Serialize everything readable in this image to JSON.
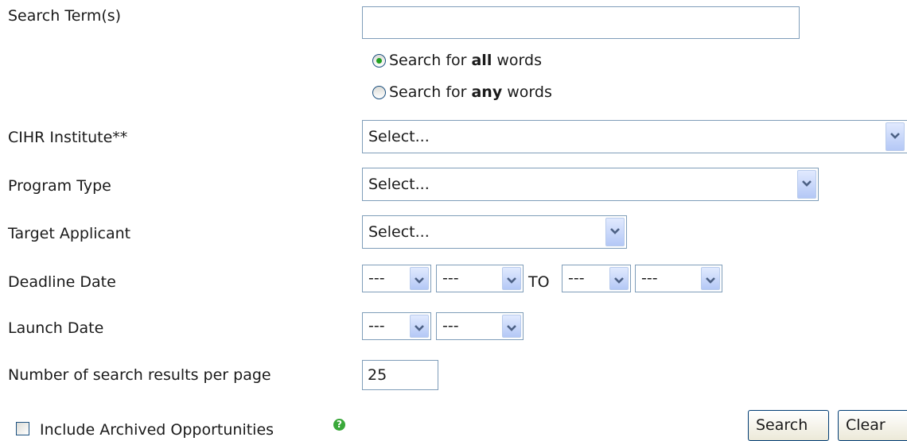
{
  "labels": {
    "search_terms": "Search Term(s)",
    "cihr_institute": "CIHR Institute**",
    "program_type": "Program Type",
    "target_applicant": "Target Applicant",
    "deadline_date": "Deadline Date",
    "launch_date": "Launch Date",
    "results_per_page": "Number of search results per page",
    "include_archived": "Include Archived Opportunities"
  },
  "search_terms": {
    "value": ""
  },
  "search_mode": {
    "selected": "all",
    "options": [
      {
        "pre": "Search for ",
        "bold": "all",
        "post": " words"
      },
      {
        "pre": "Search for ",
        "bold": "any",
        "post": " words"
      }
    ]
  },
  "selects": {
    "cihr_institute": "Select...",
    "program_type": "Select...",
    "target_applicant": "Select...",
    "deadline_from_1": "---",
    "deadline_from_2": "---",
    "deadline_to_1": "---",
    "deadline_to_2": "---",
    "launch_1": "---",
    "launch_2": "---"
  },
  "deadline_to_label": "TO",
  "results_per_page": {
    "value": "25"
  },
  "include_archived": {
    "checked": false
  },
  "icons": {
    "help": "help-question-icon",
    "dropdown": "chevron-down-icon"
  },
  "buttons": {
    "search": "Search",
    "clear": "Clear"
  },
  "colors": {
    "field_border": "#7f9db9",
    "dropdown_button": "#b4c8f6",
    "help_icon": "#3aa83a"
  }
}
